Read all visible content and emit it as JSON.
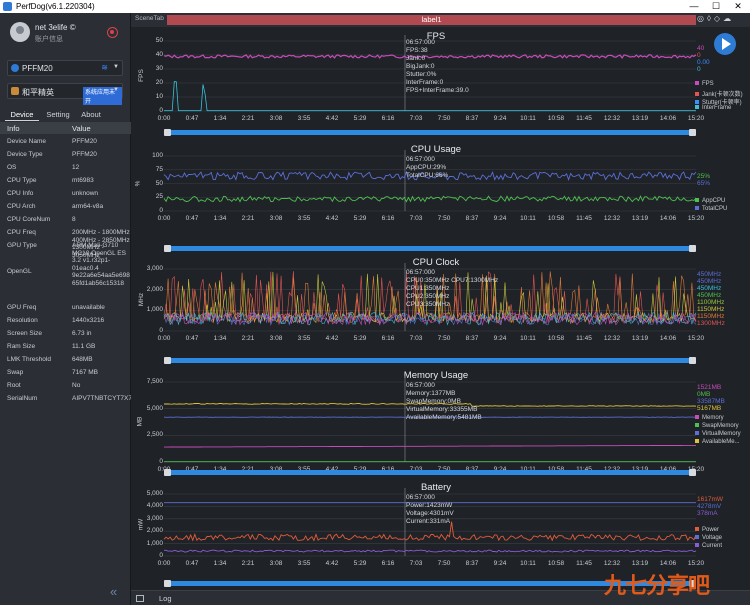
{
  "app": {
    "title": "PerfDog(v6.1.220304)",
    "win_buttons": [
      "—",
      "☐",
      "✕"
    ]
  },
  "user": {
    "name": "net 3elife ©",
    "sub": "账户信息"
  },
  "device_select": {
    "label": "PFFM20"
  },
  "app_select": {
    "label": "和平精英",
    "badge": "系统应用未开"
  },
  "tabs": [
    "Device",
    "Setting",
    "About"
  ],
  "table": {
    "headers": [
      "Info",
      "Value"
    ],
    "rows": [
      {
        "k": "Device Name",
        "v": "PFFM20"
      },
      {
        "k": "Device Type",
        "v": "PFFM20"
      },
      {
        "k": "OS",
        "v": "12"
      },
      {
        "k": "CPU Type",
        "v": "mt6983"
      },
      {
        "k": "CPU Info",
        "v": "unknown"
      },
      {
        "k": "CPU Arch",
        "v": "arm64-v8a"
      },
      {
        "k": "CPU CoreNum",
        "v": "8"
      },
      {
        "k": "CPU Freq",
        "v": "200MHz - 1800MHz 400MHz - 2850MHz 1300MHz - 3050MHz"
      },
      {
        "k": "GPU Type",
        "v": "ARM Mali-G710 MC10 OpenGL ES 3.2 v1.r32p1-01eac0.4 9e22a6e54aa5e698 65fd1ab56c15318"
      },
      {
        "k": "OpenGL",
        "v": ""
      },
      {
        "k": "GPU Freq",
        "v": "unavailable"
      },
      {
        "k": "Resolution",
        "v": "1440x3216"
      },
      {
        "k": "Screen Size",
        "v": "6.73 in"
      },
      {
        "k": "Ram Size",
        "v": "11.1 GB"
      },
      {
        "k": "LMK Threshold",
        "v": "648MB"
      },
      {
        "k": "Swap",
        "v": "7167 MB"
      },
      {
        "k": "Root",
        "v": "No"
      },
      {
        "k": "SerialNum",
        "v": "AIPV7TNBTCYT7X7D"
      }
    ]
  },
  "scene": {
    "tab": "SceneTab",
    "label": "label1"
  },
  "bottom": {
    "log": "Log"
  },
  "watermark": "九七分享吧",
  "x_ticks": [
    "0:00",
    "0:47",
    "1:34",
    "2:21",
    "3:08",
    "3:55",
    "4:42",
    "5:29",
    "6:16",
    "7:03",
    "7:50",
    "8:37",
    "9:24",
    "10:11",
    "10:58",
    "11:45",
    "12:32",
    "13:19",
    "14:06",
    "15:20"
  ],
  "chart_data": [
    {
      "type": "line",
      "title": "FPS",
      "ylabel": "FPS",
      "ylim": [
        0,
        50
      ],
      "yticks": [
        "50",
        "40",
        "30",
        "20",
        "10",
        "0"
      ],
      "tooltip": [
        "06:57:000",
        "FPS:38",
        "Jank:0",
        "BigJank:0",
        "Stutter:0%",
        "InterFrame:0",
        "FPS+InterFrame:39.0"
      ],
      "right_values": [
        {
          "text": "40",
          "color": "#c74cb9"
        },
        {
          "text": "0",
          "color": "#e05555"
        },
        {
          "text": "0.00",
          "color": "#3c8cff"
        },
        {
          "text": "0",
          "color": "#3ac0d8"
        }
      ],
      "series": [
        {
          "name": "FPS",
          "color": "#c74cb9"
        },
        {
          "name": "Jank(卡顿次数)",
          "color": "#e05555"
        },
        {
          "name": "Stutter(卡顿率)",
          "color": "#3c8cff"
        },
        {
          "name": "InterFrame",
          "color": "#3ac0d8"
        }
      ]
    },
    {
      "type": "line",
      "title": "CPU Usage",
      "ylabel": "%",
      "ylim": [
        0,
        100
      ],
      "yticks": [
        "100",
        "75",
        "50",
        "25",
        "0"
      ],
      "tooltip": [
        "06:57:000",
        "AppCPU:29%",
        "TotalCPU:66%"
      ],
      "right_values": [
        {
          "text": "25%",
          "color": "#4fc04f"
        },
        {
          "text": "65%",
          "color": "#5b6fd6"
        }
      ],
      "series": [
        {
          "name": "AppCPU",
          "color": "#4fc04f"
        },
        {
          "name": "TotalCPU",
          "color": "#5b6fd6"
        }
      ]
    },
    {
      "type": "line",
      "title": "CPU Clock",
      "ylabel": "MHz",
      "ylim": [
        0,
        3000
      ],
      "yticks": [
        "3,000",
        "2,000",
        "1,000",
        "0"
      ],
      "tooltip": [
        "06:57:000",
        "CPU0:350MHz   CPU7:1300MHz",
        "CPU1:350MHz",
        "CPU2:350MHz",
        "CPU3:350MHz"
      ],
      "right_values": [
        {
          "text": "450MHz",
          "color": "#5b6fd6"
        },
        {
          "text": "450MHz",
          "color": "#5b6fd6"
        },
        {
          "text": "450MHz",
          "color": "#3ac0d8"
        },
        {
          "text": "450MHz",
          "color": "#4fc04f"
        },
        {
          "text": "1100MHz",
          "color": "#9ac83a"
        },
        {
          "text": "1150MHz",
          "color": "#c8c83a"
        },
        {
          "text": "1150MHz",
          "color": "#e07a3a"
        },
        {
          "text": "1300MHz",
          "color": "#e05555"
        }
      ],
      "series": []
    },
    {
      "type": "line",
      "title": "Memory Usage",
      "ylabel": "MB",
      "ylim": [
        0,
        7500
      ],
      "yticks": [
        "7,500",
        "5,000",
        "2,500",
        "0"
      ],
      "tooltip": [
        "06:57:000",
        "Memory:1377MB",
        "SwapMemory:0MB",
        "VirtualMemory:33355MB",
        "AvailableMemory:5481MB"
      ],
      "right_values": [
        {
          "text": "1521MB",
          "color": "#c74cb9"
        },
        {
          "text": "0MB",
          "color": "#4fc04f"
        },
        {
          "text": "33587MB",
          "color": "#5b6fd6"
        },
        {
          "text": "5167MB",
          "color": "#e0c23a"
        }
      ],
      "series": [
        {
          "name": "Memory",
          "color": "#c74cb9"
        },
        {
          "name": "SwapMemory",
          "color": "#4fc04f"
        },
        {
          "name": "VirtualMemory",
          "color": "#5b6fd6"
        },
        {
          "name": "AvailableMe...",
          "color": "#e0c23a"
        }
      ]
    },
    {
      "type": "line",
      "title": "Battery",
      "ylabel": "mW",
      "ylim": [
        0,
        5000
      ],
      "yticks": [
        "5,000",
        "4,000",
        "3,000",
        "2,000",
        "1,000",
        "0"
      ],
      "tooltip": [
        "06:57:000",
        "Power:1423mW",
        "Voltage:4301mV",
        "Current:331mA"
      ],
      "right_values": [
        {
          "text": "1617mW",
          "color": "#e05c3a"
        },
        {
          "text": "4278mV",
          "color": "#5b6fd6"
        },
        {
          "text": "378mA",
          "color": "#8a5bd6"
        }
      ],
      "series": [
        {
          "name": "Power",
          "color": "#e05c3a"
        },
        {
          "name": "Voltage",
          "color": "#5b6fd6"
        },
        {
          "name": "Current",
          "color": "#8a5bd6"
        }
      ]
    }
  ]
}
